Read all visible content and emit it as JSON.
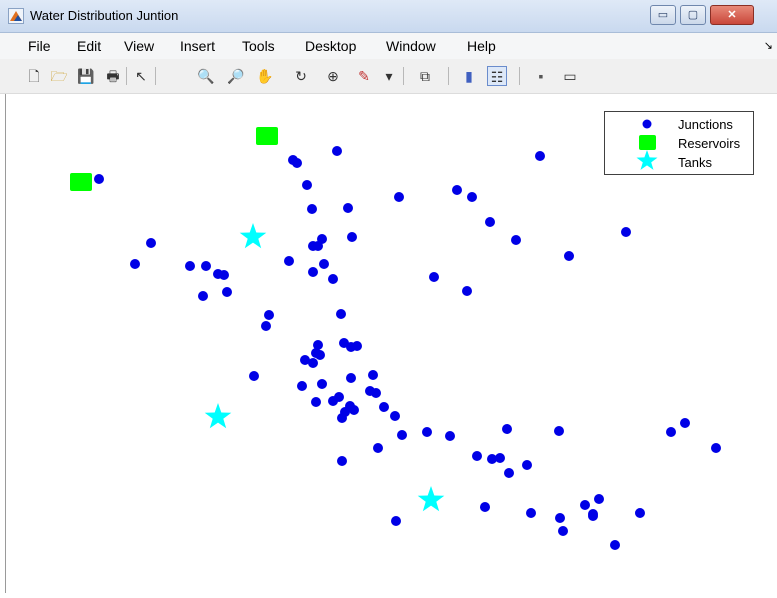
{
  "window": {
    "title": "Water Distribution Juntion",
    "minimize_glyph": "▭",
    "maximize_glyph": "▢",
    "close_glyph": "✕"
  },
  "menu": {
    "items": [
      "File",
      "Edit",
      "View",
      "Insert",
      "Tools",
      "Desktop",
      "Window",
      "Help"
    ],
    "overflow_glyph": "↘"
  },
  "toolbar": {
    "icons": [
      "new-figure-icon",
      "open-file-icon",
      "save-icon",
      "print-icon",
      "pointer-icon",
      "zoom-in-icon",
      "zoom-out-icon",
      "pan-hand-icon",
      "rotate-3d-icon",
      "data-cursor-icon",
      "brush-icon",
      "brush-dropdown-icon",
      "link-plot-icon",
      "colorbar-icon",
      "legend-icon",
      "hide-plot-tools-icon",
      "show-plot-tools-icon"
    ],
    "glyphs": [
      "🗋",
      "🗁",
      "💾",
      "🖶",
      "↖",
      "🔍",
      "🔎",
      "✋",
      "↻",
      "⊕",
      "✎",
      "▾",
      "⧉",
      "▮",
      "☷",
      "▪",
      "▭"
    ]
  },
  "colors": {
    "junction": "#0000e6",
    "reservoir": "#00ff00",
    "tank": "#00ffff"
  },
  "chart_data": {
    "type": "scatter",
    "title": "",
    "xlabel": "",
    "ylabel": "",
    "grid": false,
    "axes_visible": false,
    "legend_position": "top-right",
    "xlim": [
      0,
      772
    ],
    "ylim": [
      0,
      499
    ],
    "series": [
      {
        "name": "Junctions",
        "marker": "circle",
        "color": "#0000e6",
        "points": [
          [
            93,
            85
          ],
          [
            291,
            69
          ],
          [
            287,
            66
          ],
          [
            331,
            57
          ],
          [
            534,
            62
          ],
          [
            301,
            91
          ],
          [
            342,
            114
          ],
          [
            306,
            115
          ],
          [
            393,
            103
          ],
          [
            451,
            96
          ],
          [
            466,
            103
          ],
          [
            484,
            128
          ],
          [
            316,
            145
          ],
          [
            312,
            152
          ],
          [
            307,
            152
          ],
          [
            346,
            143
          ],
          [
            510,
            146
          ],
          [
            145,
            149
          ],
          [
            129,
            170
          ],
          [
            620,
            138
          ],
          [
            563,
            162
          ],
          [
            283,
            167
          ],
          [
            318,
            170
          ],
          [
            307,
            178
          ],
          [
            327,
            185
          ],
          [
            184,
            172
          ],
          [
            200,
            172
          ],
          [
            212,
            180
          ],
          [
            218,
            181
          ],
          [
            428,
            183
          ],
          [
            461,
            197
          ],
          [
            197,
            202
          ],
          [
            221,
            198
          ],
          [
            263,
            221
          ],
          [
            335,
            220
          ],
          [
            260,
            232
          ],
          [
            338,
            249
          ],
          [
            345,
            253
          ],
          [
            351,
            252
          ],
          [
            312,
            251
          ],
          [
            310,
            259
          ],
          [
            299,
            266
          ],
          [
            314,
            261
          ],
          [
            307,
            269
          ],
          [
            248,
            282
          ],
          [
            345,
            284
          ],
          [
            367,
            281
          ],
          [
            296,
            292
          ],
          [
            316,
            290
          ],
          [
            327,
            307
          ],
          [
            333,
            303
          ],
          [
            364,
            297
          ],
          [
            370,
            299
          ],
          [
            344,
            312
          ],
          [
            339,
            318
          ],
          [
            378,
            313
          ],
          [
            310,
            308
          ],
          [
            336,
            324
          ],
          [
            348,
            316
          ],
          [
            389,
            322
          ],
          [
            396,
            341
          ],
          [
            421,
            338
          ],
          [
            444,
            342
          ],
          [
            501,
            335
          ],
          [
            553,
            337
          ],
          [
            372,
            354
          ],
          [
            471,
            362
          ],
          [
            486,
            365
          ],
          [
            494,
            364
          ],
          [
            503,
            379
          ],
          [
            521,
            371
          ],
          [
            665,
            338
          ],
          [
            679,
            329
          ],
          [
            710,
            354
          ],
          [
            336,
            367
          ],
          [
            479,
            413
          ],
          [
            525,
            419
          ],
          [
            554,
            424
          ],
          [
            557,
            437
          ],
          [
            579,
            411
          ],
          [
            587,
            420
          ],
          [
            587,
            422
          ],
          [
            593,
            405
          ],
          [
            634,
            419
          ],
          [
            609,
            451
          ],
          [
            390,
            427
          ]
        ]
      },
      {
        "name": "Reservoirs",
        "marker": "square",
        "color": "#00ff00",
        "points": [
          [
            261,
            42
          ],
          [
            75,
            88
          ]
        ]
      },
      {
        "name": "Tanks",
        "marker": "star",
        "color": "#00ffff",
        "points": [
          [
            247,
            143
          ],
          [
            212,
            323
          ],
          [
            425,
            406
          ]
        ]
      }
    ]
  }
}
